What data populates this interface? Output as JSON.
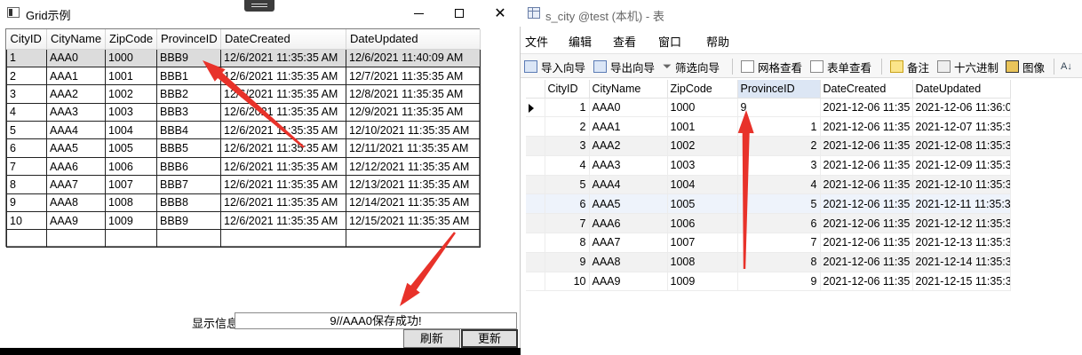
{
  "left_window": {
    "title": "Grid示例",
    "grid": {
      "columns": [
        "CityID",
        "CityName",
        "ZipCode",
        "ProvinceID",
        "DateCreated",
        "DateUpdated"
      ],
      "rows": [
        [
          "1",
          "AAA0",
          "1000",
          "BBB9",
          "12/6/2021 11:35:35 AM",
          "12/6/2021 11:40:09 AM"
        ],
        [
          "2",
          "AAA1",
          "1001",
          "BBB1",
          "12/6/2021 11:35:35 AM",
          "12/7/2021 11:35:35 AM"
        ],
        [
          "3",
          "AAA2",
          "1002",
          "BBB2",
          "12/6/2021 11:35:35 AM",
          "12/8/2021 11:35:35 AM"
        ],
        [
          "4",
          "AAA3",
          "1003",
          "BBB3",
          "12/6/2021 11:35:35 AM",
          "12/9/2021 11:35:35 AM"
        ],
        [
          "5",
          "AAA4",
          "1004",
          "BBB4",
          "12/6/2021 11:35:35 AM",
          "12/10/2021 11:35:35 AM"
        ],
        [
          "6",
          "AAA5",
          "1005",
          "BBB5",
          "12/6/2021 11:35:35 AM",
          "12/11/2021 11:35:35 AM"
        ],
        [
          "7",
          "AAA6",
          "1006",
          "BBB6",
          "12/6/2021 11:35:35 AM",
          "12/12/2021 11:35:35 AM"
        ],
        [
          "8",
          "AAA7",
          "1007",
          "BBB7",
          "12/6/2021 11:35:35 AM",
          "12/13/2021 11:35:35 AM"
        ],
        [
          "9",
          "AAA8",
          "1008",
          "BBB8",
          "12/6/2021 11:35:35 AM",
          "12/14/2021 11:35:35 AM"
        ],
        [
          "10",
          "AAA9",
          "1009",
          "BBB9",
          "12/6/2021 11:35:35 AM",
          "12/15/2021 11:35:35 AM"
        ]
      ]
    },
    "info_label": "显示信息",
    "info_value": "9//AAA0保存成功!",
    "refresh_label": "刷新",
    "update_label": "更新"
  },
  "right_window": {
    "title": "s_city @test (本机) - 表",
    "menu": [
      "文件",
      "编辑",
      "查看",
      "窗口",
      "帮助"
    ],
    "toolbar": [
      "导入向导",
      "导出向导",
      "筛选向导",
      "网格查看",
      "表单查看",
      "备注",
      "十六进制",
      "图像"
    ],
    "grid": {
      "columns": [
        "CityID",
        "CityName",
        "ZipCode",
        "ProvinceID",
        "DateCreated",
        "DateUpdated"
      ],
      "rows": [
        [
          "1",
          "AAA0",
          "1000",
          "9",
          "2021-12-06 11:35",
          "2021-12-06 11:36:0"
        ],
        [
          "2",
          "AAA1",
          "1001",
          "1",
          "2021-12-06 11:35",
          "2021-12-07 11:35:3"
        ],
        [
          "3",
          "AAA2",
          "1002",
          "2",
          "2021-12-06 11:35",
          "2021-12-08 11:35:3"
        ],
        [
          "4",
          "AAA3",
          "1003",
          "3",
          "2021-12-06 11:35",
          "2021-12-09 11:35:3"
        ],
        [
          "5",
          "AAA4",
          "1004",
          "4",
          "2021-12-06 11:35",
          "2021-12-10 11:35:3"
        ],
        [
          "6",
          "AAA5",
          "1005",
          "5",
          "2021-12-06 11:35",
          "2021-12-11 11:35:3"
        ],
        [
          "7",
          "AAA6",
          "1006",
          "6",
          "2021-12-06 11:35",
          "2021-12-12 11:35:3"
        ],
        [
          "8",
          "AAA7",
          "1007",
          "7",
          "2021-12-06 11:35",
          "2021-12-13 11:35:3"
        ],
        [
          "9",
          "AAA8",
          "1008",
          "8",
          "2021-12-06 11:35",
          "2021-12-14 11:35:3"
        ],
        [
          "10",
          "AAA9",
          "1009",
          "9",
          "2021-12-06 11:35",
          "2021-12-15 11:35:3"
        ]
      ]
    }
  },
  "annotation_color": "#e8322a"
}
